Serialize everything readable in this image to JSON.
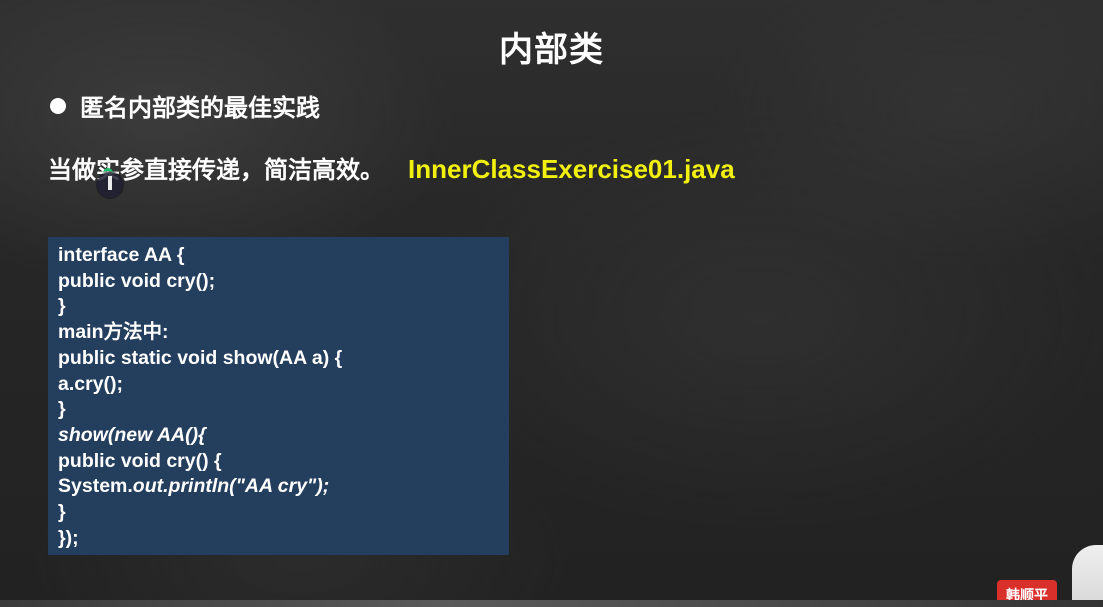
{
  "slide": {
    "title": "内部类",
    "bullet": "匿名内部类的最佳实践",
    "description": "当做实参直接传递，简洁高效。",
    "file_name": "InnerClassExercise01.java",
    "code_lines": [
      "interface AA {",
      "public void cry();",
      "}",
      "main方法中:",
      "public static void show(AA a) {",
      "a.cry();",
      "}",
      "show(new AA(){",
      "public void cry() {",
      "System.",
      "out.println(\"AA cry\");",
      "}",
      "});"
    ]
  },
  "watermark": {
    "text": "韩顺平"
  },
  "colors": {
    "background": "#2a2a2a",
    "code_box": "#243f5e",
    "file_name": "#f2f00f",
    "watermark": "#d9302c"
  }
}
